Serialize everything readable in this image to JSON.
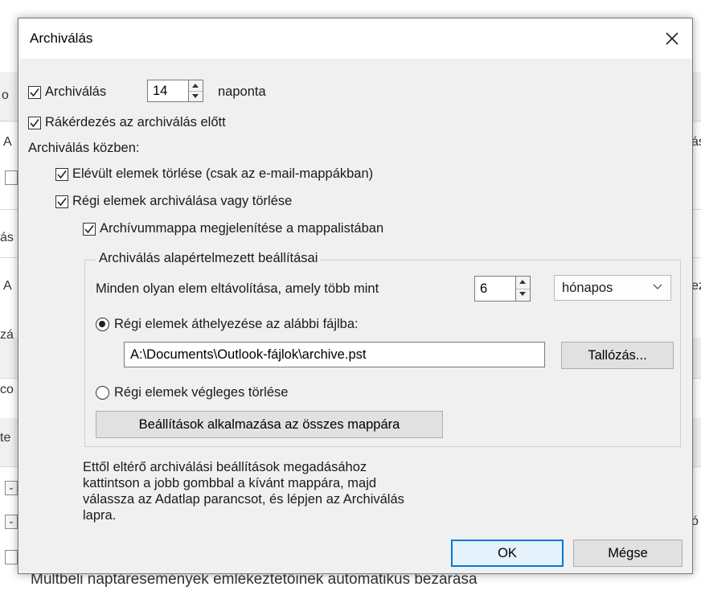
{
  "background": {
    "left_fragments": [
      "o",
      "A",
      "ás",
      "A",
      "zá",
      "co",
      "te"
    ],
    "right_fragments": [
      "ás",
      "ez",
      "ó"
    ],
    "bottom_text": "Múltbeli naptáresemények emlékeztetőinek automatikus bezárása"
  },
  "dialog": {
    "title": "Archiválás",
    "archive_every": {
      "label": "Archiválás",
      "value": "14",
      "suffix": "naponta",
      "checked": true
    },
    "prompt_before": {
      "label": "Rákérdezés az archiválás előtt",
      "checked": true
    },
    "during_label": "Archiválás közben:",
    "delete_expired": {
      "label": "Elévült elemek törlése (csak az e-mail-mappákban)",
      "checked": true
    },
    "archive_or_delete": {
      "label": "Régi elemek archiválása vagy törlése",
      "checked": true
    },
    "show_archive_folder": {
      "label": "Archívummappa megjelenítése a mappalistában",
      "checked": true
    },
    "defaults_group": {
      "label": "Archiválás alapértelmezett beállításai",
      "older_than": {
        "label": "Minden olyan elem eltávolítása, amely több mint",
        "value": "6",
        "unit": "hónapos"
      },
      "move_option": {
        "label": "Régi elemek áthelyezése az alábbi fájlba:",
        "selected": true
      },
      "file_path": "A:\\Documents\\Outlook-fájlok\\archive.pst",
      "browse_label": "Tallózás...",
      "delete_option": {
        "label": "Régi elemek végleges törlése",
        "selected": false
      },
      "apply_all_label": "Beállítások alkalmazása az összes mappára"
    },
    "note_lines": [
      "Ettől eltérő archiválási beállítások megadásához",
      "kattintson a jobb gombbal a kívánt mappára, majd",
      "válassza az Adatlap parancsot, és lépjen az Archiválás",
      "lapra."
    ],
    "ok_label": "OK",
    "cancel_label": "Mégse"
  },
  "colors": {
    "dialog_bg": "#f0f0f0",
    "primary_border": "#0078d7"
  }
}
